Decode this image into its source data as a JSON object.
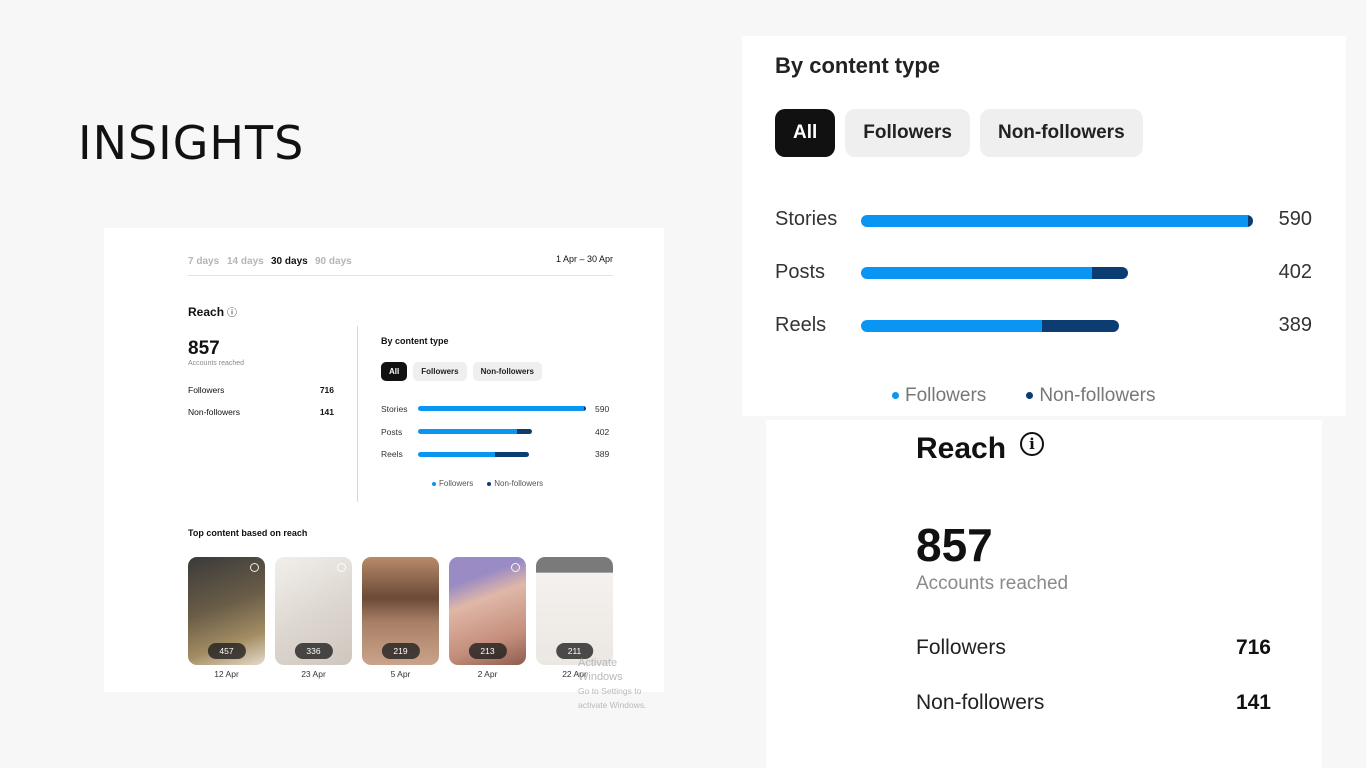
{
  "slide_title": "INSIGHTS",
  "colors": {
    "followers": "#0a95f3",
    "non_followers": "#0b3c72",
    "pill_active": "#111111",
    "pill": "#efefef"
  },
  "range": {
    "options": [
      "7 days",
      "14 days",
      "30 days",
      "90 days"
    ],
    "selected": "30 days",
    "date_range": "1 Apr – 30 Apr"
  },
  "reach": {
    "title": "Reach",
    "info_icon": "info-icon",
    "accounts_reached": "857",
    "accounts_reached_label": "Accounts reached",
    "rows": [
      {
        "label": "Followers",
        "value": "716"
      },
      {
        "label": "Non-followers",
        "value": "141"
      }
    ]
  },
  "content_type": {
    "title": "By content type",
    "filters": [
      "All",
      "Followers",
      "Non-followers"
    ],
    "selected_filter": "All",
    "legend": [
      "Followers",
      "Non-followers"
    ]
  },
  "chart_data": {
    "type": "bar",
    "orientation": "horizontal",
    "stacked": true,
    "categories": [
      "Stories",
      "Posts",
      "Reels"
    ],
    "totals": [
      590,
      402,
      389
    ],
    "series": [
      {
        "name": "Followers",
        "values": [
          583,
          348,
          272
        ]
      },
      {
        "name": "Non-followers",
        "values": [
          7,
          54,
          117
        ]
      }
    ],
    "xlim": [
      0,
      590
    ],
    "legend_position": "bottom"
  },
  "top_content": {
    "title": "Top content based on reach",
    "items": [
      {
        "reach": "457",
        "date": "12 Apr",
        "bg": "linear-gradient(160deg,#3a3a3a 0%,#6a5d48 45%,#a28c62 75%,#e6dccb 100%)"
      },
      {
        "reach": "336",
        "date": "23 Apr",
        "bg": "linear-gradient(150deg,#f2efeb 0%,#dcd6cf 55%,#cfc7be 100%)"
      },
      {
        "reach": "219",
        "date": "5 Apr",
        "bg": "linear-gradient(180deg,#b88a6a 0%,#6b4a38 38%,#a77f66 60%,#caa48a 100%)"
      },
      {
        "reach": "213",
        "date": "2 Apr",
        "bg": "linear-gradient(160deg,#9a8bc4 0%,#9a8bc4 22%,#e0b7a8 40%,#c48d7b 75%,#8d5c50 100%)"
      },
      {
        "reach": "211",
        "date": "22 Apr",
        "bg": "linear-gradient(180deg,#7a7a7a 0%,#7a7a7a 14%,#f4f1ee 15%,#ece7e2 100%)"
      }
    ]
  },
  "watermark": {
    "line1": "Activate Windows",
    "line2": "Go to Settings to activate Windows."
  }
}
